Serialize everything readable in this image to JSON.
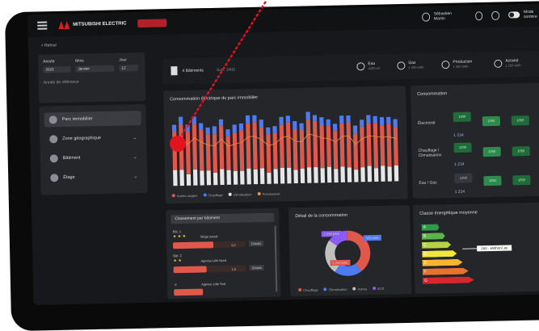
{
  "header": {
    "logo_text": "MITSUBISHI ELECTRIC",
    "partner_logo": "",
    "user_name": "Sébastien Martin",
    "mode_label": "Mode sombre"
  },
  "breadcrumb": "< Retour",
  "filters": {
    "year_label": "Année",
    "month_label": "Mois",
    "day_label": "Jour",
    "year_value": "2023",
    "month_value": "Janvier",
    "day_value": "12",
    "checkbox_label": "Année de référence"
  },
  "nav": {
    "items": [
      {
        "label": "Parc immobilier",
        "active": true
      },
      {
        "label": "Zone géographique",
        "active": false
      },
      {
        "label": "Bâtiment",
        "active": false
      },
      {
        "label": "Étage",
        "active": false
      }
    ]
  },
  "kpibar": {
    "buildings_label": "4 Bâtiments",
    "area_label": "Surf. 3400",
    "kpis": [
      {
        "title": "Eau",
        "sub": "4200 m³"
      },
      {
        "title": "Gaz",
        "sub": "1 500 kWh"
      },
      {
        "title": "Production",
        "sub": "1 250 kWh"
      },
      {
        "title": "Activité",
        "sub": "1 250 kWh"
      }
    ]
  },
  "chart_title": "Consommation électrique du parc immobilier",
  "chart_data": {
    "type": "bar",
    "categories": [
      "1",
      "2",
      "3",
      "4",
      "5",
      "6",
      "7",
      "8",
      "9",
      "10",
      "11",
      "12",
      "13",
      "14",
      "15",
      "16",
      "17",
      "18",
      "19",
      "20",
      "21",
      "22",
      "23",
      "24",
      "25",
      "26",
      "27",
      "28",
      "29",
      "30",
      "31",
      "32",
      "33",
      "34"
    ],
    "series": [
      {
        "name": "Autres usages",
        "values": [
          14,
          14,
          10,
          14,
          13,
          13,
          11,
          14,
          13,
          12,
          12,
          14,
          13,
          14,
          10,
          13,
          14,
          14,
          12,
          13,
          14,
          14,
          13,
          14,
          12,
          14,
          13,
          11,
          13,
          14,
          12,
          14,
          13,
          14
        ]
      },
      {
        "name": "Chauffage",
        "values": [
          34,
          40,
          38,
          40,
          36,
          32,
          34,
          38,
          30,
          34,
          36,
          40,
          42,
          36,
          34,
          32,
          38,
          40,
          36,
          34,
          42,
          40,
          38,
          36,
          34,
          38,
          40,
          32,
          36,
          38,
          40,
          36,
          38,
          34
        ]
      },
      {
        "name": "Climatisation",
        "values": [
          6,
          7,
          6,
          7,
          6,
          6,
          7,
          6,
          6,
          7,
          6,
          7,
          6,
          7,
          6,
          6,
          7,
          6,
          7,
          6,
          7,
          6,
          7,
          6,
          6,
          7,
          6,
          7,
          6,
          7,
          6,
          7,
          6,
          7
        ]
      }
    ],
    "ylim": [
      0,
      70
    ],
    "legend": [
      "Autres usages",
      "Chauffage",
      "Climatisation",
      "Prévisionnel"
    ]
  },
  "consumption": {
    "title": "Consommation",
    "rows": [
      {
        "label": "Électricité",
        "total": "1 234",
        "values": [
          "1200",
          "1050",
          "1050"
        ]
      },
      {
        "label": "Chauffage / Climatisation",
        "total": "1 234",
        "values": [
          "1200",
          "1050",
          "1050"
        ]
      },
      {
        "label": "Eau / Gaz",
        "total": "1 234",
        "values": [
          "1200",
          "1050",
          "1050"
        ]
      }
    ]
  },
  "ranking": {
    "select_value": "Classement par bâtiment",
    "items": [
      {
        "rank": "Bât. 1",
        "name": "Siège social",
        "progress": 0.55,
        "value": "1,5",
        "btn": "Détails"
      },
      {
        "rank": "Bât. 2",
        "name": "Agence Lille Nord",
        "progress": 0.45,
        "value": "1,5",
        "btn": "Détails"
      },
      {
        "rank": "Bât. 3",
        "name": "Agence Lille Sud",
        "progress": 0.4,
        "value": "",
        "btn": ""
      }
    ]
  },
  "cost": {
    "title": "Détail de la consommation",
    "segments": [
      {
        "label": "Chauffage",
        "value": 40,
        "color": "#e0584c"
      },
      {
        "label": "Climatisation",
        "value": 20,
        "color": "#4f7bf2"
      },
      {
        "label": "Autres",
        "value": 25,
        "color": "#c0c0c0"
      },
      {
        "label": "ECS",
        "value": 15,
        "color": "#8a5cf5"
      }
    ],
    "tags": [
      "1 500 kWh",
      "500 kWh",
      "1 250 kWh"
    ],
    "legend": [
      "Chauffage",
      "Climatisation",
      "Autres",
      "ECS"
    ]
  },
  "dpe": {
    "title": "Classe énergétique moyenne",
    "classes": [
      "A",
      "B",
      "C",
      "D",
      "E",
      "F",
      "G"
    ],
    "colors": [
      "#2f9a48",
      "#5db44a",
      "#b7d344",
      "#f2e63a",
      "#f6b431",
      "#e8722e",
      "#d6272c"
    ],
    "current_label": "160 - kWh/m².an",
    "current_class": "C"
  }
}
